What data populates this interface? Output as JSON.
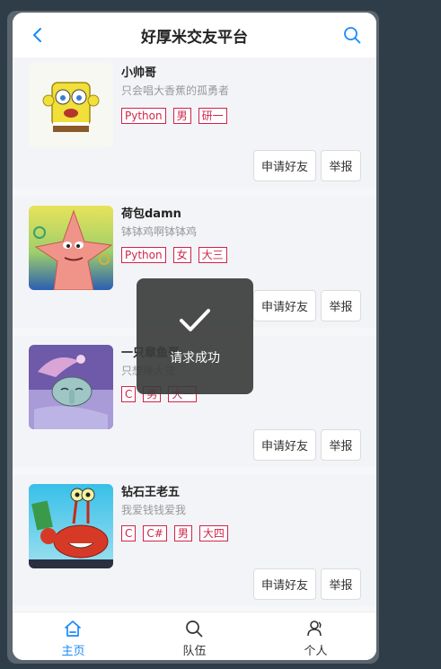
{
  "header": {
    "title": "好厚米交友平台",
    "back_icon": "chevron-left-icon",
    "search_icon": "search-icon"
  },
  "colors": {
    "accent": "#1989fa",
    "tag": "#d0244a"
  },
  "users": [
    {
      "name": "小帅哥",
      "desc": "只会唱大香蕉的孤勇者",
      "tags": [
        "Python",
        "男",
        "研一"
      ],
      "avatar": "spongebob-avatar",
      "add_label": "申请好友",
      "report_label": "举报"
    },
    {
      "name": "荷包damn",
      "desc": "钵钵鸡啊钵钵鸡",
      "tags": [
        "Python",
        "女",
        "大三"
      ],
      "avatar": "patrick-avatar",
      "add_label": "申请好友",
      "report_label": "举报"
    },
    {
      "name": "一只章鱼哥",
      "desc": "只想睡大觉",
      "tags": [
        "C",
        "男",
        "大一"
      ],
      "avatar": "squidward-avatar",
      "add_label": "申请好友",
      "report_label": "举报"
    },
    {
      "name": "钻石王老五",
      "desc": "我爱钱钱爱我",
      "tags": [
        "C",
        "C#",
        "男",
        "大四"
      ],
      "avatar": "mr-krabs-avatar",
      "add_label": "申请好友",
      "report_label": "举报"
    }
  ],
  "toast": {
    "text": "请求成功",
    "icon": "check-icon"
  },
  "tabbar": {
    "tabs": [
      {
        "label": "主页",
        "icon": "home-icon",
        "active": true
      },
      {
        "label": "队伍",
        "icon": "search-icon",
        "active": false
      },
      {
        "label": "个人",
        "icon": "user-icon",
        "active": false
      }
    ]
  }
}
